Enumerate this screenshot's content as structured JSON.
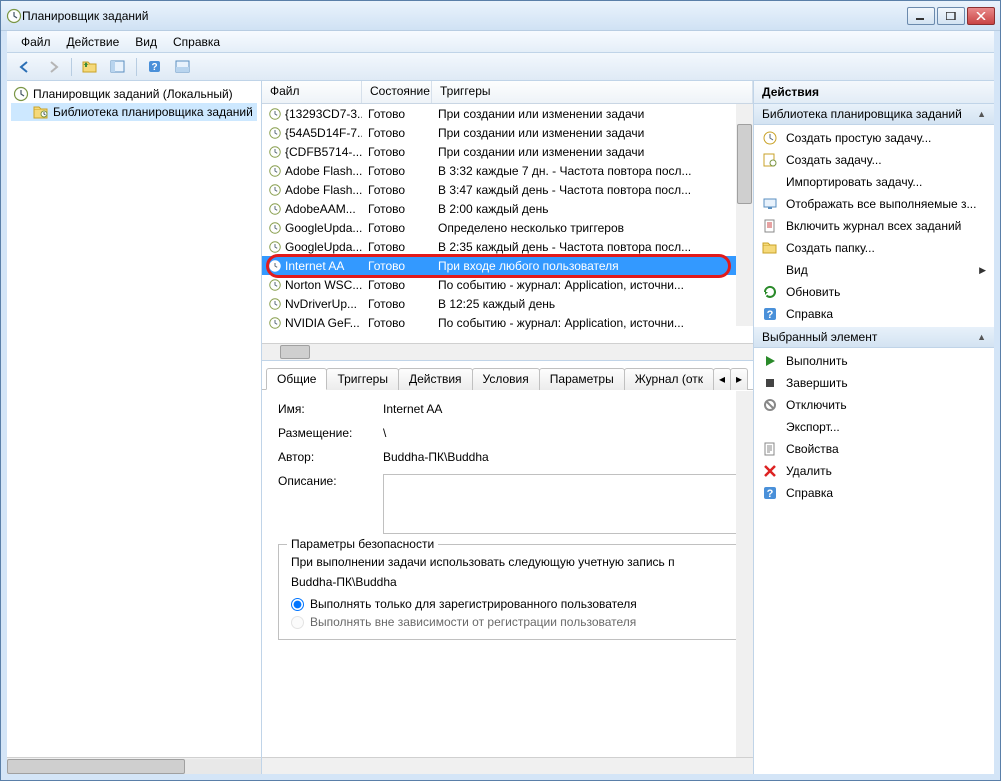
{
  "title": "Планировщик заданий",
  "menubar": [
    "Файл",
    "Действие",
    "Вид",
    "Справка"
  ],
  "tree": {
    "root": "Планировщик заданий (Локальный)",
    "child": "Библиотека планировщика заданий"
  },
  "columns": {
    "file": "Файл",
    "state": "Состояние",
    "triggers": "Триггеры"
  },
  "tasks": [
    {
      "name": "{13293CD7-3...",
      "state": "Готово",
      "trigger": "При создании или изменении задачи"
    },
    {
      "name": "{54A5D14F-7...",
      "state": "Готово",
      "trigger": "При создании или изменении задачи"
    },
    {
      "name": "{CDFB5714-...",
      "state": "Готово",
      "trigger": "При создании или изменении задачи"
    },
    {
      "name": "Adobe Flash...",
      "state": "Готово",
      "trigger": "В 3:32 каждые 7 дн. - Частота повтора посл..."
    },
    {
      "name": "Adobe Flash...",
      "state": "Готово",
      "trigger": "В 3:47 каждый день - Частота повтора посл..."
    },
    {
      "name": "AdobeAAM...",
      "state": "Готово",
      "trigger": "В 2:00 каждый день"
    },
    {
      "name": "GoogleUpda...",
      "state": "Готово",
      "trigger": "Определено несколько триггеров"
    },
    {
      "name": "GoogleUpda...",
      "state": "Готово",
      "trigger": "В 2:35 каждый день - Частота повтора посл..."
    },
    {
      "name": "Internet AA",
      "state": "Готово",
      "trigger": "При входе любого пользователя",
      "selected": true
    },
    {
      "name": "Norton WSC...",
      "state": "Готово",
      "trigger": "По событию - журнал: Application, источни..."
    },
    {
      "name": "NvDriverUp...",
      "state": "Готово",
      "trigger": "В 12:25 каждый день"
    },
    {
      "name": "NVIDIA GeF...",
      "state": "Готово",
      "trigger": "По событию - журнал: Application, источни..."
    }
  ],
  "tabs": [
    "Общие",
    "Триггеры",
    "Действия",
    "Условия",
    "Параметры",
    "Журнал (отк"
  ],
  "detail": {
    "name_label": "Имя:",
    "name_value": "Internet AA",
    "location_label": "Размещение:",
    "location_value": "\\",
    "author_label": "Автор:",
    "author_value": "Buddha-ПК\\Buddha",
    "description_label": "Описание:",
    "description_value": "",
    "security_group": "Параметры безопасности",
    "security_text": "При выполнении задачи использовать следующую учетную запись п",
    "security_account": "Buddha-ПК\\Buddha",
    "radio1": "Выполнять только для зарегистрированного пользователя",
    "radio2": "Выполнять вне зависимости от регистрации пользователя"
  },
  "actions": {
    "header": "Действия",
    "group1": "Библиотека планировщика заданий",
    "group1_items": [
      {
        "icon": "wizard",
        "label": "Создать простую задачу..."
      },
      {
        "icon": "new",
        "label": "Создать задачу..."
      },
      {
        "icon": "import",
        "label": "Импортировать задачу..."
      },
      {
        "icon": "display",
        "label": "Отображать все выполняемые з..."
      },
      {
        "icon": "log",
        "label": "Включить журнал всех заданий"
      },
      {
        "icon": "folder",
        "label": "Создать папку..."
      },
      {
        "icon": "view",
        "label": "Вид",
        "chevron": true
      },
      {
        "icon": "refresh",
        "label": "Обновить"
      },
      {
        "icon": "help",
        "label": "Справка"
      }
    ],
    "group2": "Выбранный элемент",
    "group2_items": [
      {
        "icon": "run",
        "label": "Выполнить"
      },
      {
        "icon": "stop",
        "label": "Завершить"
      },
      {
        "icon": "disable",
        "label": "Отключить"
      },
      {
        "icon": "export",
        "label": "Экспорт..."
      },
      {
        "icon": "props",
        "label": "Свойства"
      },
      {
        "icon": "delete",
        "label": "Удалить"
      },
      {
        "icon": "help",
        "label": "Справка"
      }
    ]
  }
}
